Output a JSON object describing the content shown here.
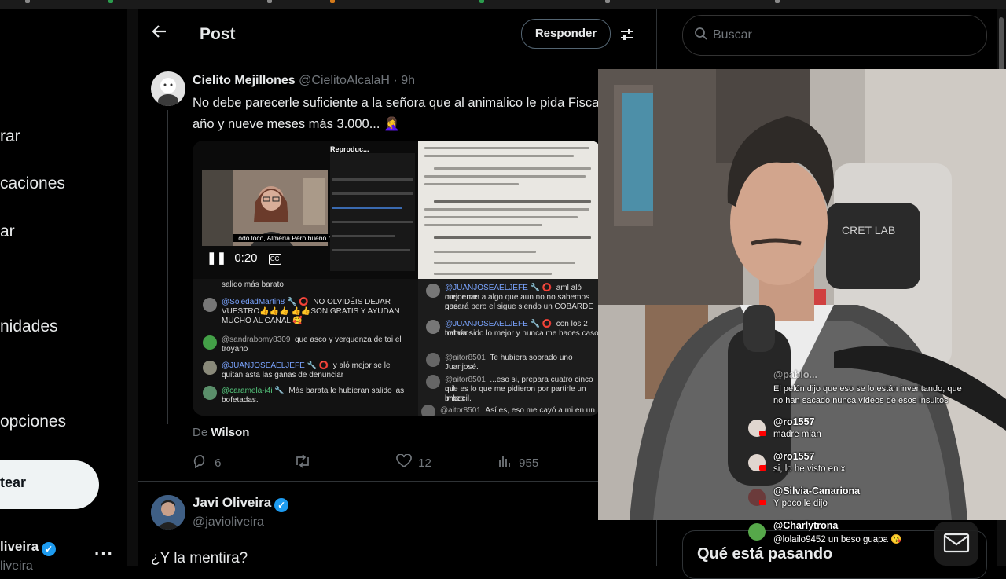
{
  "left_nav": {
    "items": [
      {
        "label": "rar"
      },
      {
        "label": "caciones"
      },
      {
        "label": "ar"
      },
      {
        "label": "nidades"
      },
      {
        "label": "opciones"
      }
    ],
    "post_button": "tear",
    "profile_name": "liveira",
    "profile_handle": "liveira"
  },
  "header": {
    "title": "Post",
    "reply_button": "Responder",
    "back_icon": "arrow-left-icon",
    "filter_icon": "sliders-icon"
  },
  "tweet": {
    "author_name": "Cielito Mejillones",
    "author_handle": "@CielitoAlcalaH",
    "time": "· 9h",
    "text_line1": " No debe parecerle suficiente a la señora que al animalico le pida Fisca",
    "text_line2": "año y nueve meses más 3.000... 🤦‍♀️",
    "media": {
      "player_title": "Reproduc...",
      "caption": "Todo loco, Almería Pero bueno que no pasa nada",
      "time": "0:20",
      "cc": "CC",
      "chat_left": [
        {
          "user": "",
          "text": "salido más barato"
        },
        {
          "user": "@SoledadMartin8",
          "text": "NO OLVIDÉIS DEJAR"
        },
        {
          "user": "",
          "text": "VUESTRO👍👍👍 👍👍SON GRATIS Y AYUDAN"
        },
        {
          "user": "",
          "text": "MUCHO AL CANAL 🥰"
        },
        {
          "user": "@sandrabomy8309",
          "text": "que asco y verguenza de toi el"
        },
        {
          "user": "",
          "text": "troyano"
        },
        {
          "user": "@JUANJOSEAELJEFE",
          "text": "y aló mejor se le"
        },
        {
          "user": "",
          "text": "quitan asta las ganas de denunciar"
        },
        {
          "user": "@caramela-i4i",
          "text": "Más barata le hubieran salido las"
        },
        {
          "user": "",
          "text": "bofetadas."
        }
      ],
      "chat_right": [
        {
          "user": "@JUANJOSEAELJEFE",
          "text": "aml aló mejor me"
        },
        {
          "user": "",
          "text": "condenan a algo que aun no no sabemos que"
        },
        {
          "user": "",
          "text": "pasará pero el sigue siendo un COBARDE"
        },
        {
          "user": "@JUANJOSEAELJEFE",
          "text": "con los 2 tortazos"
        },
        {
          "user": "",
          "text": "habría sido lo mejor y nunca me haces caso"
        },
        {
          "user": "@aitor8501",
          "text": "Te hubiera sobrado uno Juanjosé."
        },
        {
          "user": "@aitor8501",
          "text": "...eso si, prepara cuatro cinco mil"
        },
        {
          "user": "",
          "text": "que es lo que me pidieron por partirle un brazo"
        },
        {
          "user": "",
          "text": "imbecil."
        },
        {
          "user": "@aitor8501",
          "text": "Así es, eso me cayó a mi en un juic"
        }
      ]
    },
    "credit_prefix": "De",
    "credit_name": "Wilson",
    "stats": {
      "replies": "6",
      "retweets": "",
      "likes": "12",
      "views": "955"
    }
  },
  "reply": {
    "author_name": "Javi Oliveira",
    "author_handle": "@javioliveira",
    "text": "¿Y la mentira?"
  },
  "right": {
    "search_placeholder": "Buscar",
    "trends_title": "Qué está pasando"
  },
  "stream_chat": [
    {
      "user": "@pablo...",
      "text": "El pelón dijo que eso se lo están inventando, que",
      "text2": "no han sacado nunca vídeos de esos insultos"
    },
    {
      "user": "@ro1557",
      "text": "madre mian"
    },
    {
      "user": "@ro1557",
      "text": "si, lo he visto en x"
    },
    {
      "user": "@Silvia-Canariona",
      "text": "Y poco le dijo"
    },
    {
      "user": "@Charlytrona",
      "text": "@lolailo9452 un beso guapa 😘"
    }
  ],
  "webcam_sign": "CRET LAB",
  "colors": {
    "accent": "#1d9bf0",
    "background": "#000000",
    "muted": "#71767b"
  }
}
